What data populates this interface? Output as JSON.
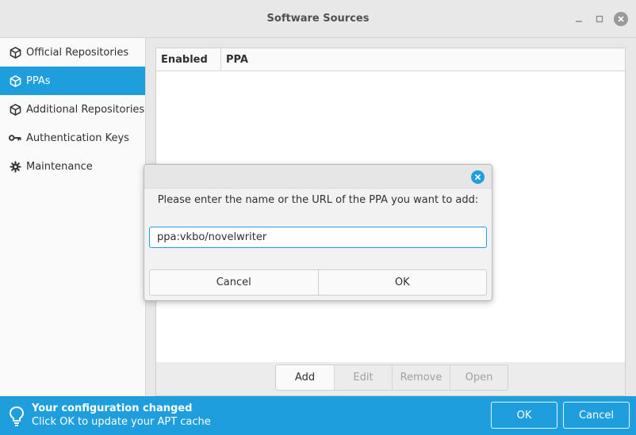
{
  "window": {
    "title": "Software Sources",
    "controls": {
      "minimize_icon": "minimize-icon",
      "maximize_icon": "maximize-icon",
      "close_icon": "close-icon"
    }
  },
  "sidebar": {
    "items": [
      {
        "label": "Official Repositories",
        "icon": "package-icon",
        "active": false
      },
      {
        "label": "PPAs",
        "icon": "package-icon",
        "active": true
      },
      {
        "label": "Additional Repositories",
        "icon": "package-icon",
        "active": false
      },
      {
        "label": "Authentication Keys",
        "icon": "key-icon",
        "active": false
      },
      {
        "label": "Maintenance",
        "icon": "gear-icon",
        "active": false
      }
    ]
  },
  "table": {
    "columns": [
      "Enabled",
      "PPA"
    ],
    "rows": []
  },
  "toolbar": {
    "add_label": "Add",
    "edit_label": "Edit",
    "remove_label": "Remove",
    "open_label": "Open"
  },
  "infobar": {
    "title": "Your configuration changed",
    "subtitle": "Click OK to update your APT cache",
    "ok_label": "OK",
    "cancel_label": "Cancel",
    "icon": "lightbulb-icon"
  },
  "dialog": {
    "message": "Please enter the name or the URL of the PPA you want to add:",
    "input_value": "ppa:vkbo/novelwriter",
    "cancel_label": "Cancel",
    "ok_label": "OK"
  },
  "colors": {
    "accent": "#1f9ede",
    "window_bg": "#e8e8e8",
    "sidebar_bg": "#fafafa"
  }
}
